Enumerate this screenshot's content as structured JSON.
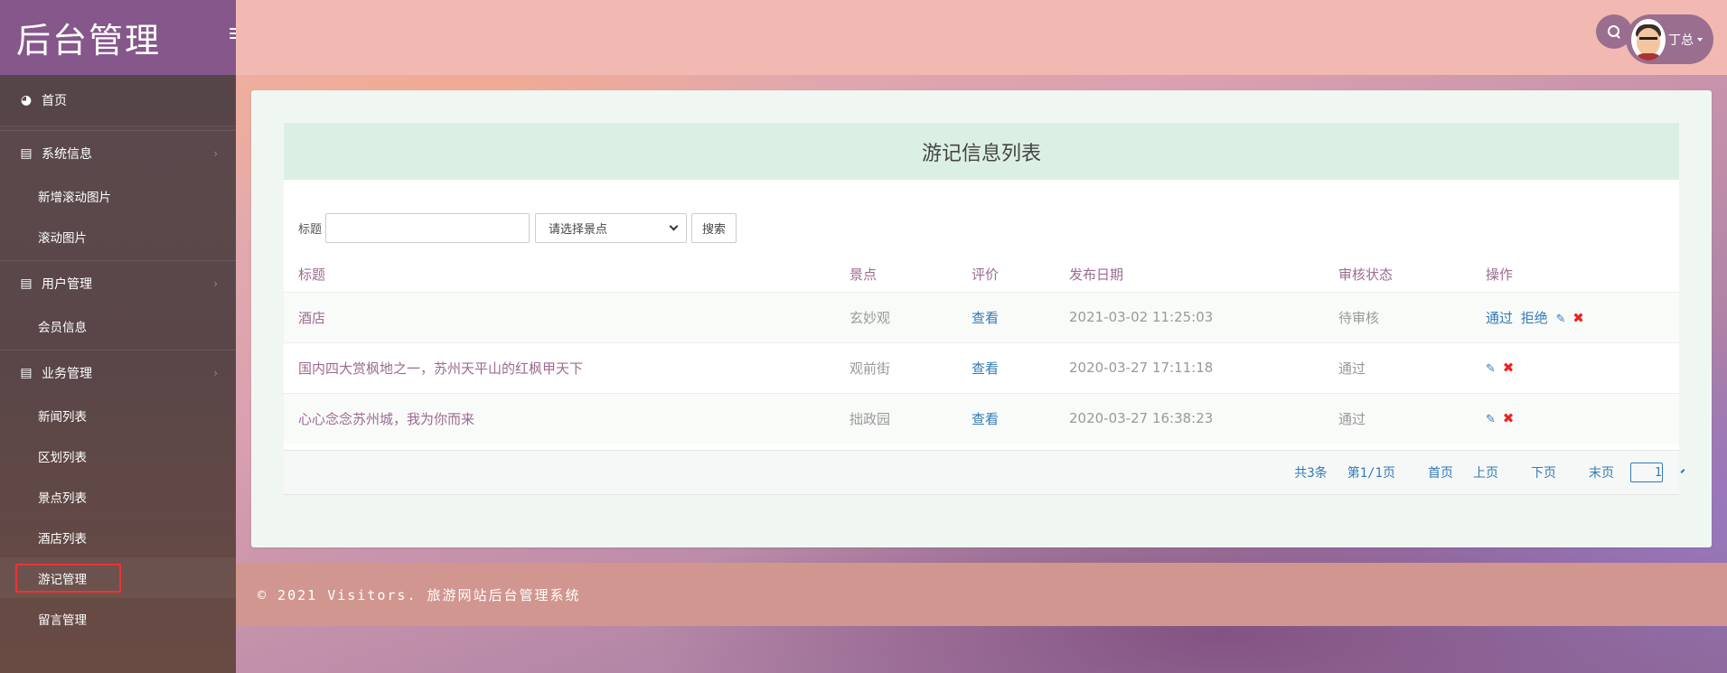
{
  "brand": {
    "title": "后台管理"
  },
  "sidebar": {
    "home": "首页",
    "groups": [
      {
        "label": "系统信息",
        "items": [
          "新增滚动图片",
          "滚动图片"
        ]
      },
      {
        "label": "用户管理",
        "items": [
          "会员信息"
        ]
      },
      {
        "label": "业务管理",
        "items": [
          "新闻列表",
          "区划列表",
          "景点列表",
          "酒店列表",
          "游记管理",
          "留言管理"
        ]
      }
    ]
  },
  "header": {
    "user_name": "丁总"
  },
  "panel": {
    "title": "游记信息列表",
    "filters": {
      "title_label": "标题",
      "title_value": "",
      "spot_select": "请选择景点",
      "search_button": "搜索"
    },
    "columns": [
      "标题",
      "景点",
      "评价",
      "发布日期",
      "审核状态",
      "操作"
    ],
    "rows": [
      {
        "title": "酒店",
        "spot": "玄妙观",
        "review": "查看",
        "date": "2021-03-02 11:25:03",
        "status": "待审核",
        "actions": [
          "通过",
          "拒绝"
        ]
      },
      {
        "title": "国内四大赏枫地之一，苏州天平山的红枫甲天下",
        "spot": "观前街",
        "review": "查看",
        "date": "2020-03-27 17:11:18",
        "status": "通过",
        "actions": []
      },
      {
        "title": "心心念念苏州城，我为你而来",
        "spot": "拙政园",
        "review": "查看",
        "date": "2020-03-27 16:38:23",
        "status": "通过",
        "actions": []
      }
    ],
    "pager": {
      "total": "共3条",
      "page": "第1/1页",
      "first": "首页",
      "prev": "上页",
      "next": "下页",
      "last": "末页",
      "current": "1"
    }
  },
  "footer": {
    "text": "© 2021 Visitors. 旅游网站后台管理系统"
  },
  "colors": {
    "brand": "#86578b",
    "header": "#f2b9b2",
    "footer": "#d1968f",
    "link": "#337ab7",
    "accent_text": "#9b6b92",
    "delete": "#e22222"
  }
}
